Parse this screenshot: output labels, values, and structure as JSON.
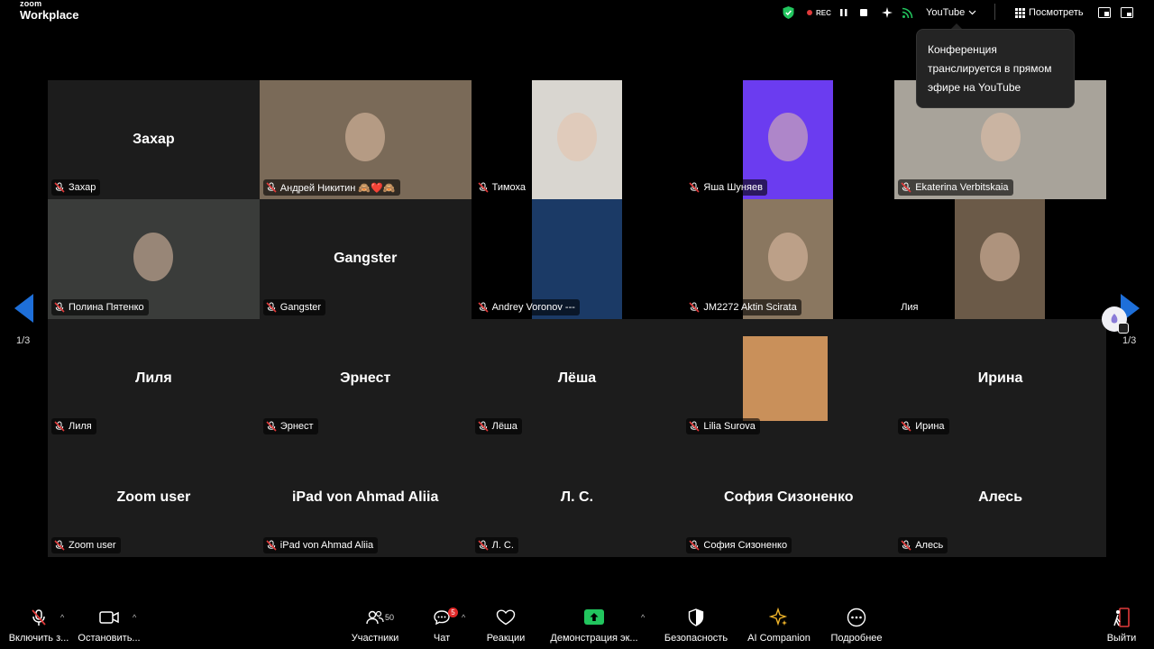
{
  "app": {
    "logo_top": "zoom",
    "logo_bottom": "Workplace"
  },
  "topbar": {
    "rec_label": "REC",
    "stream_target": "YouTube",
    "view_label": "Посмотреть"
  },
  "tooltip": {
    "text": "Конференция транслируется в прямом эфире на YouTube"
  },
  "tiles": [
    {
      "name": "Захар",
      "label": "Захар",
      "style": "name"
    },
    {
      "name": "",
      "label": "Андрей Никитин 🙈❤️🙈",
      "style": "video-full",
      "color": "#7a6a58"
    },
    {
      "name": "",
      "label": "Тимоха",
      "style": "video-center",
      "color": "#d9d6d0"
    },
    {
      "name": "",
      "label": "Яша Шуняев",
      "style": "video-center",
      "color": "#6b3cf0"
    },
    {
      "name": "",
      "label": "Ekaterina Verbitskaia",
      "style": "video-full-hl",
      "color": "#a8a39a"
    },
    {
      "name": "",
      "label": "Полина Пятенко",
      "style": "video-full",
      "color": "#3a3c3a"
    },
    {
      "name": "Gangster",
      "label": "Gangster",
      "style": "name"
    },
    {
      "name": "",
      "label": "Andrey Voronov ---",
      "style": "video-center",
      "color": "#1b3a66"
    },
    {
      "name": "",
      "label": "JM2272 Aktin Scirata",
      "style": "video-center",
      "color": "#8a7760"
    },
    {
      "name": "",
      "label": "Лия",
      "style": "video-right",
      "color": "#6b5a48"
    },
    {
      "name": "Лиля",
      "label": "Лиля",
      "style": "name"
    },
    {
      "name": "Эрнест",
      "label": "Эрнест",
      "style": "name"
    },
    {
      "name": "Лёша",
      "label": "Лёша",
      "style": "name"
    },
    {
      "name": "",
      "label": "Lilia Surova",
      "style": "avatar-img",
      "color": "#c9905a"
    },
    {
      "name": "Ирина",
      "label": "Ирина",
      "style": "name"
    },
    {
      "name": "Zoom user",
      "label": "Zoom user",
      "style": "name"
    },
    {
      "name": "iPad von Ahmad Aliia",
      "label": "iPad von Ahmad Aliia",
      "style": "name"
    },
    {
      "name": "Л. С.",
      "label": "Л. С.",
      "style": "name"
    },
    {
      "name": "София Сизоненко",
      "label": "София Сизоненко",
      "style": "name"
    },
    {
      "name": "Алесь",
      "label": "Алесь",
      "style": "name"
    }
  ],
  "pagination": {
    "left": "1/3",
    "right": "1/3"
  },
  "toolbar": {
    "mute": "Включить з...",
    "video": "Остановить...",
    "participants": "Участники",
    "participants_count": "50",
    "chat": "Чат",
    "chat_badge": "5",
    "reactions": "Реакции",
    "share": "Демонстрация эк...",
    "security": "Безопасность",
    "ai": "AI Companion",
    "more": "Подробнее",
    "leave": "Выйти"
  },
  "colors": {
    "accent": "#1e6fd9",
    "share_green": "#22c55e",
    "mic_red": "#e03a3a",
    "highlight": "#c8d66b"
  }
}
